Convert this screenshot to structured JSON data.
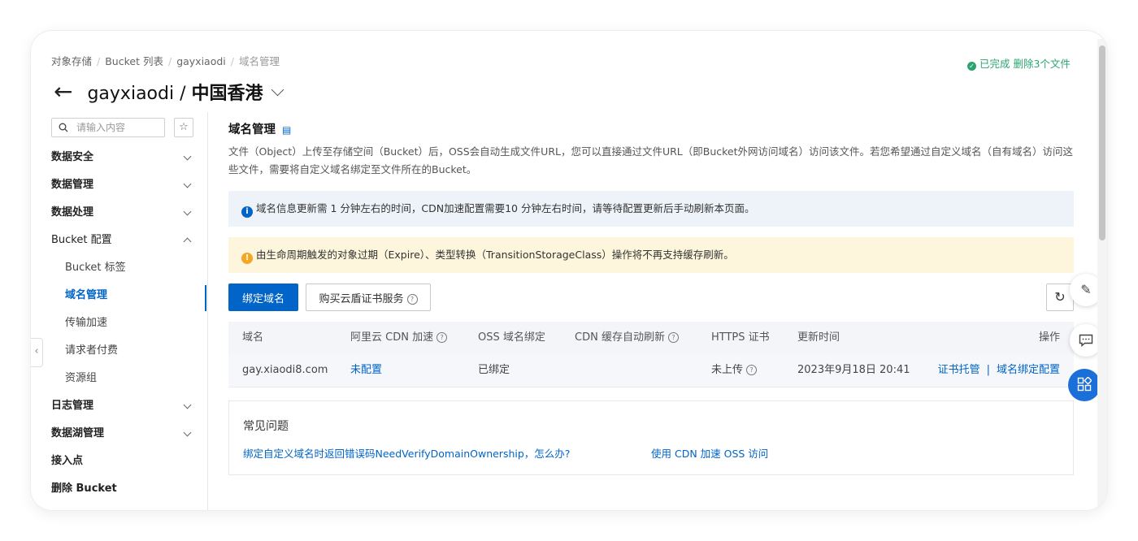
{
  "breadcrumb": [
    "对象存储",
    "Bucket 列表",
    "gayxiaodi",
    "域名管理"
  ],
  "status": {
    "text": "已完成 删除3个文件",
    "color": "#2ba471"
  },
  "header": {
    "bucket": "gayxiaodi",
    "separator": " / ",
    "region": "中国香港"
  },
  "sidebar": {
    "search_placeholder": "请输入内容",
    "items": [
      {
        "label": "数据安全",
        "expand": "down"
      },
      {
        "label": "数据管理",
        "expand": "down"
      },
      {
        "label": "数据处理",
        "expand": "down"
      },
      {
        "label": "Bucket 配置",
        "expand": "up"
      },
      {
        "label": "Bucket 标签"
      },
      {
        "label": "域名管理",
        "active": true
      },
      {
        "label": "传输加速"
      },
      {
        "label": "请求者付费"
      },
      {
        "label": "资源组"
      },
      {
        "label": "日志管理",
        "expand": "down"
      },
      {
        "label": "数据湖管理",
        "expand": "down"
      },
      {
        "label": "接入点"
      },
      {
        "label": "删除 Bucket"
      }
    ]
  },
  "main": {
    "section_title": "域名管理",
    "description": "文件（Object）上传至存储空间（Bucket）后，OSS会自动生成文件URL，您可以直接通过文件URL（即Bucket外网访问域名）访问该文件。若您希望通过自定义域名（自有域名）访问这些文件，需要将自定义域名绑定至文件所在的Bucket。",
    "info_notice": "域名信息更新需 1 分钟左右的时间，CDN加速配置需要10 分钟左右时间，请等待配置更新后手动刷新本页面。",
    "warn_notice": "由生命周期触发的对象过期（Expire）、类型转换（TransitionStorageClass）操作将不再支持缓存刷新。",
    "bind_button": "绑定域名",
    "buy_cert_button": "购买云盾证书服务",
    "table": {
      "columns": [
        "域名",
        "阿里云 CDN 加速",
        "OSS 域名绑定",
        "CDN 缓存自动刷新",
        "HTTPS 证书",
        "更新时间",
        "操作"
      ],
      "rows": [
        {
          "domain": "gay.xiaodi8.com",
          "cdn": "未配置",
          "oss_binding": "已绑定",
          "cdn_refresh": "",
          "https": "未上传",
          "updated": "2023年9月18日 20:41",
          "actions": [
            "证书托管",
            "域名绑定配置"
          ]
        }
      ]
    },
    "faq": {
      "title": "常见问题",
      "links": [
        "绑定自定义域名时返回错误码NeedVerifyDomainOwnership，怎么办?",
        "使用 CDN 加速 OSS 访问"
      ]
    }
  },
  "colors": {
    "accent": "#0064c8",
    "info_bg": "#eef3fa",
    "warn_bg": "#fdf6dc",
    "warn_icon": "#f5a623"
  },
  "icons": {
    "back": "arrow-left-icon",
    "refresh": "refresh-icon",
    "edit": "edit-icon",
    "chat": "chat-icon",
    "apps": "apps-icon"
  }
}
